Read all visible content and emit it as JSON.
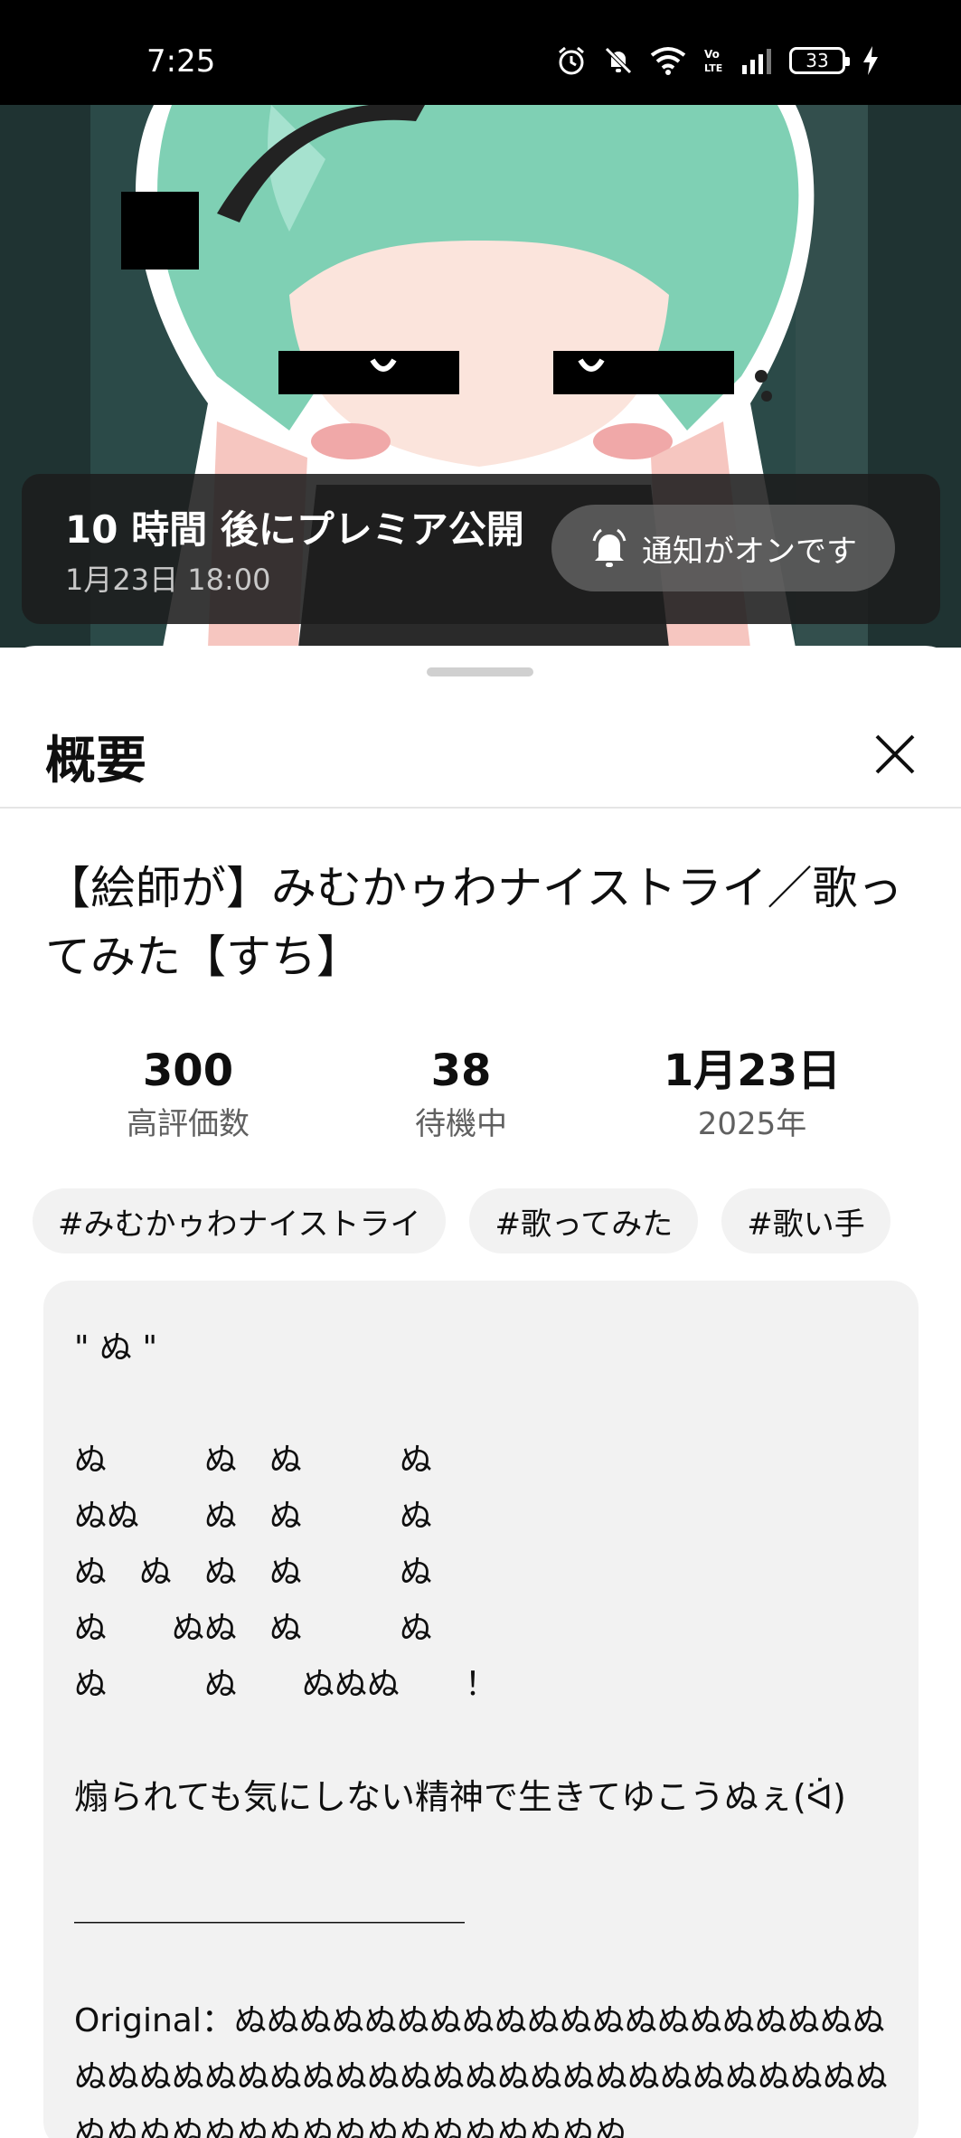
{
  "status_bar": {
    "time": "7:25",
    "battery": "33",
    "icons": [
      "alarm-icon",
      "mute-icon",
      "wifi-icon",
      "volte-icon",
      "signal-icon",
      "battery-icon",
      "charging-icon"
    ]
  },
  "premiere": {
    "title": "10 時間 後にプレミア公開",
    "date": "1月23日 18:00",
    "notify_label": "通知がオンです"
  },
  "sheet": {
    "title": "概要"
  },
  "video": {
    "title": "【絵師が】みむかゥわナイストライ／歌ってみた【すち】"
  },
  "stats": [
    {
      "value": "300",
      "label": "高評価数"
    },
    {
      "value": "38",
      "label": "待機中"
    },
    {
      "value": "1月23日",
      "label": "2025年"
    }
  ],
  "tags": [
    "#みむかゥわナイストライ",
    "#歌ってみた",
    "#歌い手"
  ],
  "description": {
    "lines": [
      "\" ぬ \"",
      "",
      "ぬ　　　ぬ　ぬ　　　ぬ",
      "ぬぬ　　ぬ　ぬ　　　ぬ",
      "ぬ　ぬ　ぬ　ぬ　　　ぬ",
      "ぬ　　ぬぬ　ぬ　　　ぬ",
      "ぬ　　　ぬ　　ぬぬぬ　　！",
      "",
      "煽られても気にしない精神で生きてゆこうぬぇ(ᐛ)",
      "",
      "＿＿＿＿＿＿＿＿＿＿＿＿",
      "",
      "Original：ぬぬぬぬぬぬぬぬぬぬぬぬぬぬぬぬぬぬぬぬぬぬぬぬぬぬぬぬぬぬぬぬぬぬぬぬぬぬぬぬぬぬぬぬぬぬぬぬぬぬぬぬぬぬぬぬぬぬぬぬぬぬ"
    ]
  },
  "colors": {
    "background": "#ffffff",
    "chip_bg": "#f2f2f2",
    "secondary_text": "#606060"
  }
}
